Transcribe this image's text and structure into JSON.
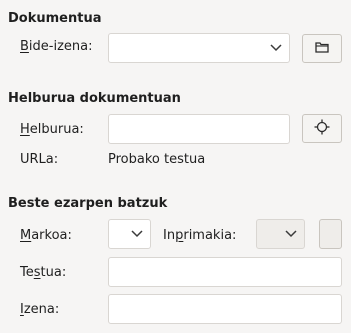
{
  "document": {
    "title": "Dokumentua",
    "frame_name_label": {
      "key": "B",
      "rest": "ide-izena:"
    },
    "frame_name_value": ""
  },
  "link": {
    "title": "Helburua dokumentuan",
    "target_label": {
      "key": "H",
      "rest": "elburua:"
    },
    "target_value": "",
    "url_label": "URLa:",
    "url_value": "Probako testua"
  },
  "further": {
    "title": "Beste ezarpen batzuk",
    "mark_label": {
      "pre": "",
      "key": "M",
      "post": "arkoa:"
    },
    "format_label": {
      "pre": "In",
      "key": "p",
      "post": "rimakia:"
    },
    "text_label": {
      "pre": "Te",
      "key": "s",
      "post": "tua:"
    },
    "name_label": {
      "pre": "",
      "key": "I",
      "post": "zena:"
    },
    "text_value": "",
    "name_value": ""
  },
  "icons": {
    "dropdown": "chevron-down-icon",
    "open_file": "folder-icon",
    "target_picker": "target-icon"
  }
}
